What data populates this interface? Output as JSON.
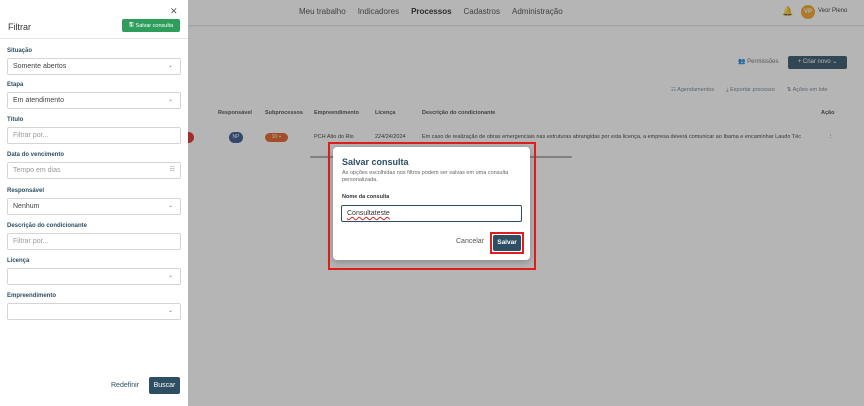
{
  "topbar": {
    "nav": [
      "Meu trabalho",
      "Indicadores",
      "Processos",
      "Cadastros",
      "Administração"
    ],
    "active_nav": "Processos",
    "avatar_initials": "VP",
    "user_name": "Veor Pleno"
  },
  "page": {
    "permissoes_label": "Permissões",
    "criar_novo_label": "+ Criar novo",
    "agendamentos_label": "Agendamentos",
    "exportar_label": "Exportar processo",
    "acoes_lote_label": "Ações em lote",
    "columns": [
      "Responsável",
      "Subprocessos",
      "Empreendimento",
      "Licença",
      "Descrição do condicionante",
      "Ação"
    ],
    "row": {
      "responsavel": "NP",
      "subprocessos": "10 +",
      "empreendimento": "PCH Alto do Rio",
      "licenca": "224/24/2024",
      "descricao": "Em caso de realização de obras emergenciais nas estruturas abrangidas por esta licença, a empresa deverá comunicar ao Ibama e encaminhar Laudo Téc"
    }
  },
  "drawer": {
    "title": "Filtrar",
    "salvar_consulta_label": "Salvar consulta",
    "fields": [
      {
        "label": "Situação",
        "value": "Somente abertos",
        "placeholder": "",
        "type": "select"
      },
      {
        "label": "Etapa",
        "value": "Em atendimento",
        "placeholder": "",
        "type": "select"
      },
      {
        "label": "Título",
        "value": "",
        "placeholder": "Filtrar por...",
        "type": "text"
      },
      {
        "label": "Data do vencimento",
        "value": "",
        "placeholder": "Tempo em dias",
        "type": "date"
      },
      {
        "label": "Responsável",
        "value": "Nenhum",
        "placeholder": "",
        "type": "select"
      },
      {
        "label": "Descrição do condicionante",
        "value": "",
        "placeholder": "Filtrar por...",
        "type": "text"
      },
      {
        "label": "Licença",
        "value": "",
        "placeholder": "",
        "type": "select"
      },
      {
        "label": "Empreendimento",
        "value": "",
        "placeholder": "",
        "type": "select"
      }
    ],
    "redefinir_label": "Redefinir",
    "buscar_label": "Buscar"
  },
  "modal": {
    "title": "Salvar consulta",
    "description": "As opções escolhidas nos filtros podem ser salvas em uma consulta personalizada.",
    "input_label": "Nome da consulta",
    "input_value": "Consultateste",
    "cancel_label": "Cancelar",
    "save_label": "Salvar"
  },
  "colors": {
    "primary": "#2d4e63",
    "success": "#2f9e5c",
    "highlight": "#e01e1e",
    "badge_orange": "#e25a1c"
  },
  "icons": [
    "close-icon",
    "save-icon",
    "chevron-down-icon",
    "calendar-icon",
    "bell-icon",
    "user-group-icon",
    "plus-icon",
    "calendar-icon",
    "download-icon",
    "sort-icon",
    "more-vertical-icon"
  ]
}
